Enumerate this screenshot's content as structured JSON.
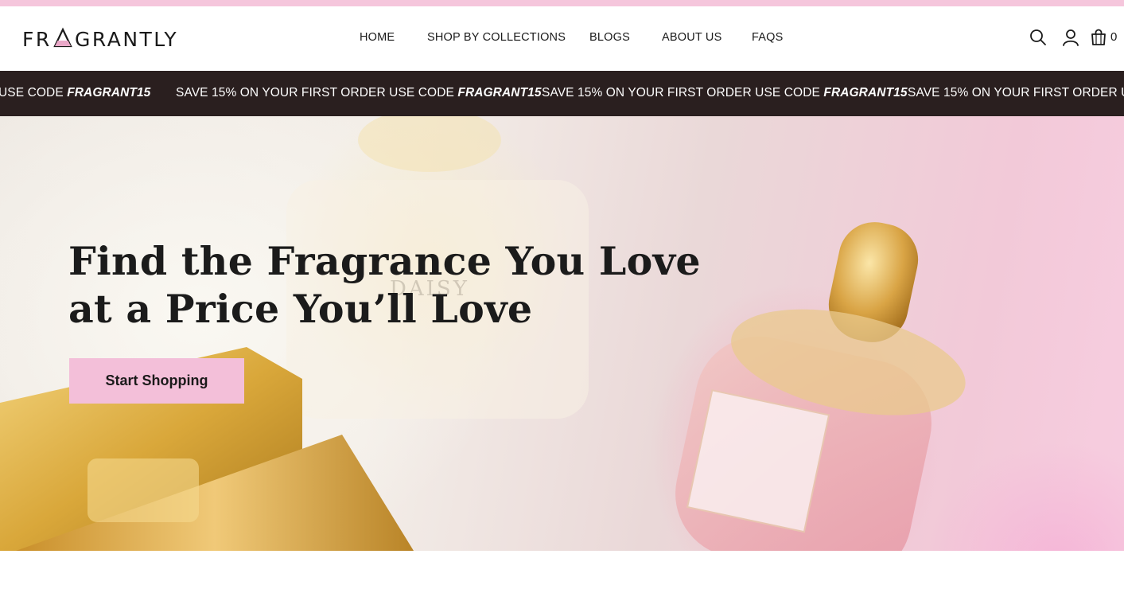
{
  "brand": {
    "name": "FRAGRANTLY",
    "colors": {
      "accent": "#f3bfd9",
      "promo_bg": "#2a1f1f",
      "top_strip": "#f5c6dc",
      "text": "#1a1a1a"
    }
  },
  "nav": {
    "items": [
      {
        "label": "HOME"
      },
      {
        "label": "SHOP BY COLLECTIONS"
      },
      {
        "label": "BLOGS"
      },
      {
        "label": "ABOUT US"
      },
      {
        "label": "FAQS"
      }
    ]
  },
  "header_icons": {
    "search": "search-icon",
    "account": "user-icon",
    "cart": "shopping-bag-icon",
    "cart_count": "0"
  },
  "promo": {
    "text": "SAVE 15% ON YOUR FIRST ORDER USE CODE",
    "code": "FRAGRANT15",
    "partial_start": "USE CODE",
    "partial_end": "SAVE 15% ON YOUR FIRST ORDER USE"
  },
  "hero": {
    "title_line1": "Find the Fragrance You Love",
    "title_line2": "at a Price You’ll Love",
    "cta_label": "Start Shopping"
  }
}
